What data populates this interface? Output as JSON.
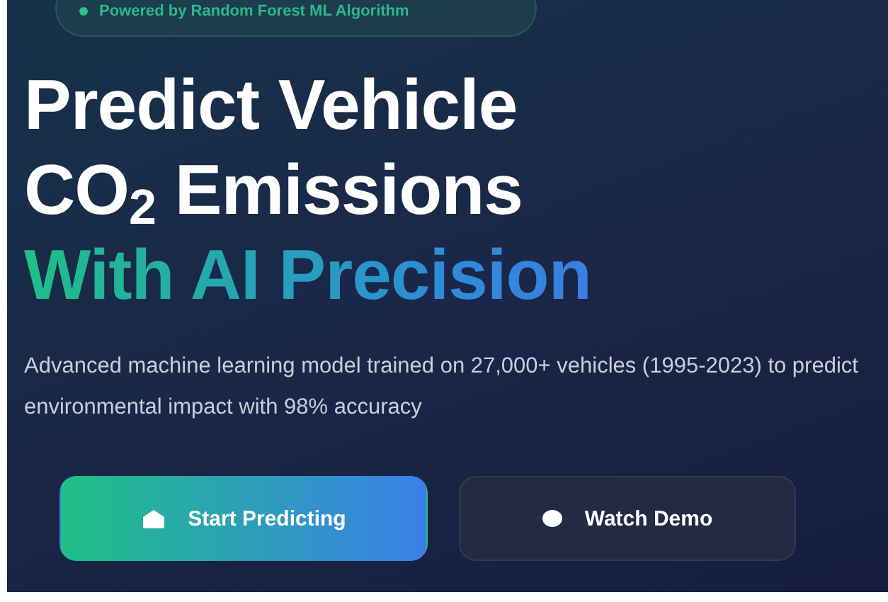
{
  "badge": {
    "text": "Powered by Random Forest ML Algorithm"
  },
  "headline": {
    "lines": [
      "Predict Vehicle",
      "CO$_{2}$ Emissions"
    ],
    "accent": "With AI Precision"
  },
  "description": "Advanced machine learning model trained on 27,000+ vehicles (1995-2023) to predict environmental impact with 98% accuracy",
  "buttons": [
    {
      "label": "Start Predicting",
      "kind": "primary"
    },
    {
      "label": "Watch Demo",
      "kind": "secondary"
    }
  ]
}
